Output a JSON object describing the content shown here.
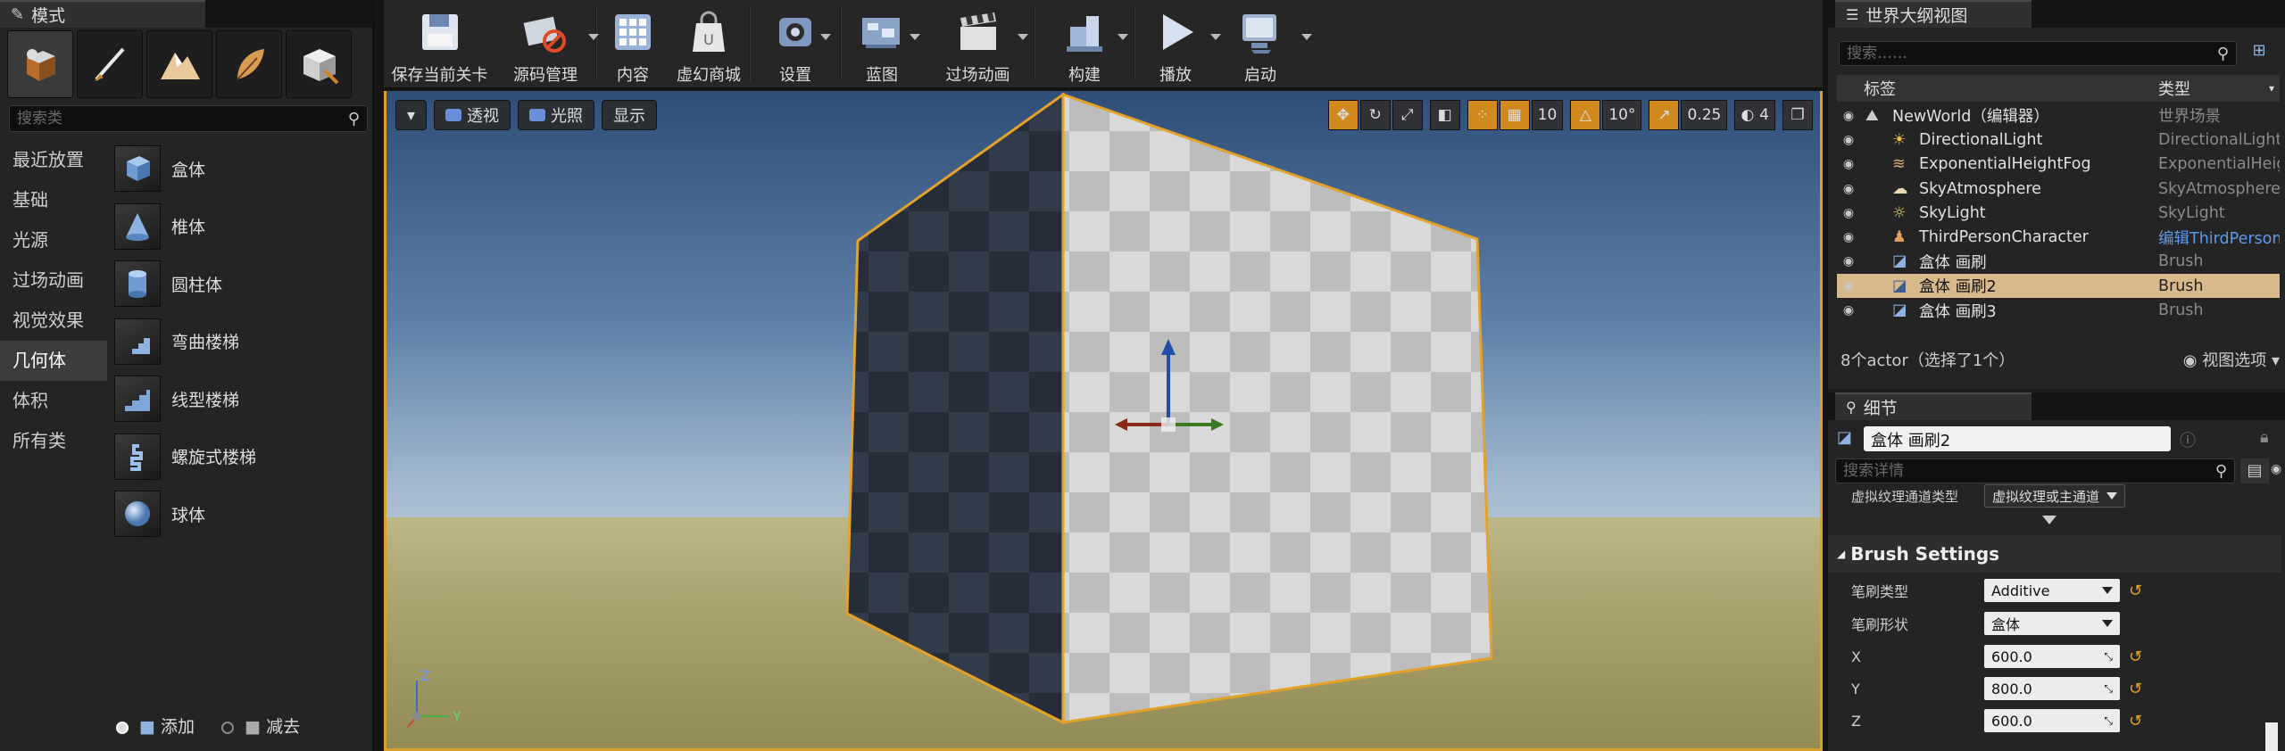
{
  "modes_panel": {
    "tab_title": "模式",
    "search_placeholder": "搜索类",
    "categories": [
      "最近放置",
      "基础",
      "光源",
      "过场动画",
      "视觉效果",
      "几何体",
      "体积",
      "所有类"
    ],
    "active_category": "几何体",
    "items": [
      "盒体",
      "椎体",
      "圆柱体",
      "弯曲楼梯",
      "线型楼梯",
      "螺旋式楼梯",
      "球体"
    ],
    "brush_add": "添加",
    "brush_subtract": "减去"
  },
  "toolbar": {
    "save": "保存当前关卡",
    "source_control": "源码管理",
    "content": "内容",
    "marketplace": "虚幻商城",
    "settings": "设置",
    "blueprints": "蓝图",
    "cinematics": "过场动画",
    "build": "构建",
    "play": "播放",
    "launch": "启动"
  },
  "viewport": {
    "perspective": "透视",
    "lit": "光照",
    "show": "显示",
    "grid_snap": "10",
    "rotation_snap": "10°",
    "scale_snap": "0.25",
    "camera_speed": "4",
    "axis_z": "Z",
    "axis_y": "Y"
  },
  "outliner": {
    "tab_title": "世界大纲视图",
    "search_placeholder": "搜索……",
    "col_label": "标签",
    "col_type": "类型",
    "rows": [
      {
        "name": "NewWorld（编辑器）",
        "type": "世界场景"
      },
      {
        "name": "DirectionalLight",
        "type": "DirectionalLight"
      },
      {
        "name": "ExponentialHeightFog",
        "type": "ExponentialHeightFog"
      },
      {
        "name": "SkyAtmosphere",
        "type": "SkyAtmosphere"
      },
      {
        "name": "SkyLight",
        "type": "SkyLight"
      },
      {
        "name": "ThirdPersonCharacter",
        "type": "编辑ThirdPersonCharacter"
      },
      {
        "name": "盒体 画刷",
        "type": "Brush"
      },
      {
        "name": "盒体 画刷2",
        "type": "Brush"
      },
      {
        "name": "盒体 画刷3",
        "type": "Brush"
      }
    ],
    "footer_count": "8个actor（选择了1个）",
    "view_options": "视图选项"
  },
  "details": {
    "tab_title": "细节",
    "object_name": "盒体 画刷2",
    "search_placeholder": "搜索详情",
    "vt_label": "虚拟纹理通道类型",
    "vt_value": "虚拟纹理或主通道",
    "section": "Brush Settings",
    "brush_type_label": "笔刷类型",
    "brush_type_value": "Additive",
    "brush_shape_label": "笔刷形状",
    "brush_shape_value": "盒体",
    "x_label": "X",
    "x_value": "600.0",
    "y_label": "Y",
    "y_value": "800.0",
    "z_label": "Z",
    "z_value": "600.0"
  },
  "colors": {
    "selection_outline": "#d9a12a",
    "selected_row": "#d8b98b",
    "accent_orange": "#d28a1e"
  }
}
